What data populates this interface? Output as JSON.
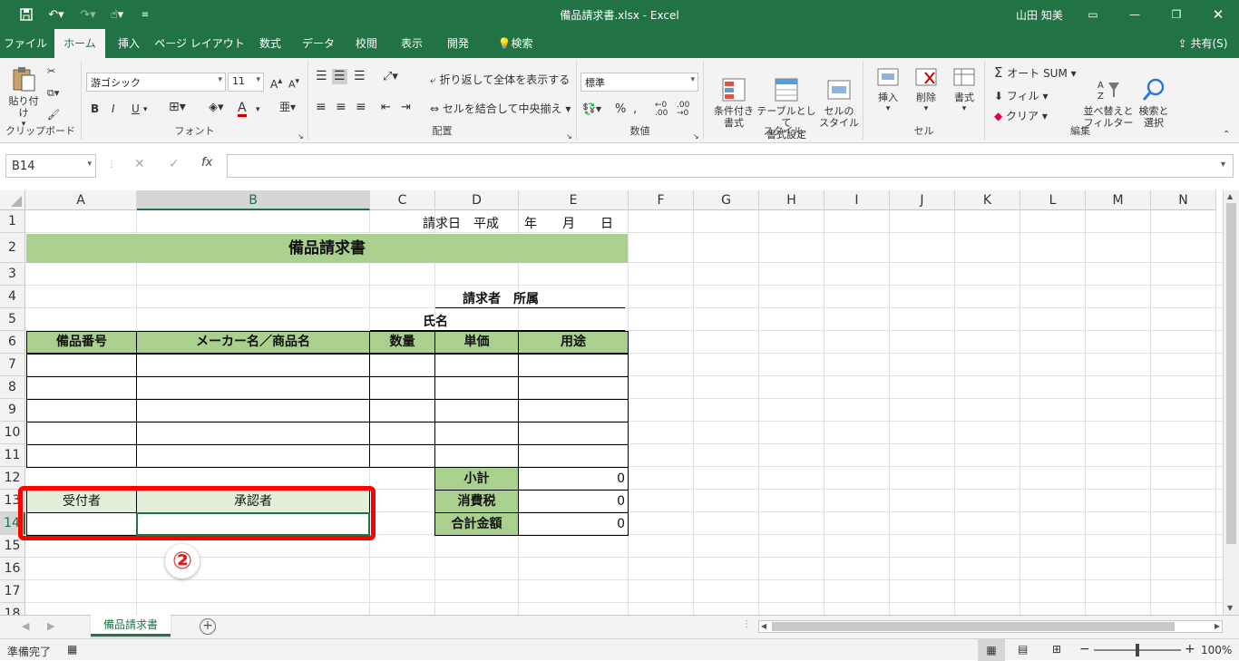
{
  "app": {
    "window_title": "備品請求書.xlsx - Excel",
    "user_name": "山田 知美"
  },
  "tabs": [
    "ファイル",
    "ホーム",
    "挿入",
    "ページ レイアウト",
    "数式",
    "データ",
    "校閲",
    "表示",
    "開発",
    "検索"
  ],
  "share_label": "共有(S)",
  "ribbon": {
    "clipboard": {
      "paste": "貼り付け",
      "group": "クリップボード"
    },
    "font": {
      "name": "游ゴシック",
      "size": "11",
      "bold": "B",
      "italic": "I",
      "underline": "U",
      "group": "フォント"
    },
    "alignment": {
      "wrap": "折り返して全体を表示する",
      "merge": "セルを結合して中央揃え",
      "group": "配置"
    },
    "number": {
      "format": "標準",
      "group": "数値"
    },
    "styles": {
      "conditional": "条件付き\n書式",
      "table": "テーブルとして\n書式設定",
      "cell": "セルの\nスタイル",
      "group": "スタイル"
    },
    "cells": {
      "insert": "挿入",
      "delete": "削除",
      "format": "書式",
      "group": "セル"
    },
    "editing": {
      "autosum": "オート SUM",
      "fill": "フィル",
      "clear": "クリア",
      "sort": "並べ替えと\nフィルター",
      "find": "検索と\n選択",
      "group": "編集"
    }
  },
  "formula_bar": {
    "name_box": "B14",
    "fx": "fx",
    "content": ""
  },
  "columns": [
    "A",
    "B",
    "C",
    "D",
    "E",
    "F",
    "G",
    "H",
    "I",
    "J",
    "K",
    "L",
    "M",
    "N"
  ],
  "rows": [
    "1",
    "2",
    "3",
    "4",
    "5",
    "6",
    "7",
    "8",
    "9",
    "10",
    "11",
    "12",
    "13",
    "14",
    "15",
    "16",
    "17",
    "18"
  ],
  "sheet": {
    "date_line": "請求日　平成　　年　　月　　日",
    "title": "備品請求書",
    "requester": "請求者　所属",
    "name": "氏名",
    "headers": [
      "備品番号",
      "メーカー名／商品名",
      "数量",
      "単価",
      "用途"
    ],
    "subtotal_label": "小計",
    "subtotal": "0",
    "tax_label": "消費税",
    "tax": "0",
    "total_label": "合計金額",
    "total": "0",
    "receiver": "受付者",
    "approver": "承認者",
    "step_marker": "②"
  },
  "sheet_tab": "備品請求書",
  "status": {
    "ready": "準備完了",
    "zoom": "100%"
  },
  "colors": {
    "excel_green": "#217346",
    "header_green": "#a9d08e",
    "light_green": "#e2efda",
    "highlight_red": "#ff0000"
  }
}
